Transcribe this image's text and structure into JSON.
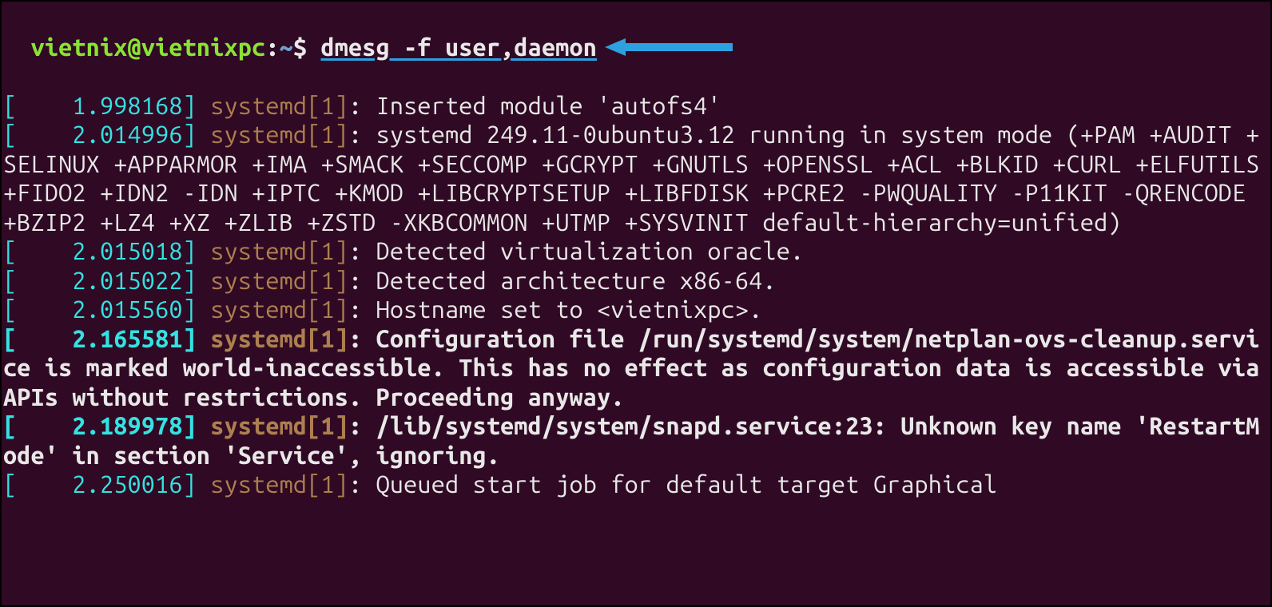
{
  "prompt": {
    "user": "vietnix",
    "at": "@",
    "host": "vietnixpc",
    "colon": ":",
    "path": "~",
    "dollar": "$ ",
    "command": "dmesg -f user,daemon"
  },
  "lines": [
    {
      "open": "[",
      "ts": "    1.998168",
      "close": "] ",
      "proc": "systemd[1]",
      "sep": ": ",
      "msg": "Inserted module 'autofs4'",
      "bold": false
    },
    {
      "open": "[",
      "ts": "    2.014996",
      "close": "] ",
      "proc": "systemd[1]",
      "sep": ": ",
      "msg": "systemd 249.11-0ubuntu3.12 running in system mode (+PAM +AUDIT +SELINUX +APPARMOR +IMA +SMACK +SECCOMP +GCRYPT +GNUTLS +OPENSSL +ACL +BLKID +CURL +ELFUTILS +FIDO2 +IDN2 -IDN +IPTC +KMOD +LIBCRYPTSETUP +LIBFDISK +PCRE2 -PWQUALITY -P11KIT -QRENCODE +BZIP2 +LZ4 +XZ +ZLIB +ZSTD -XKBCOMMON +UTMP +SYSVINIT default-hierarchy=unified)",
      "bold": false
    },
    {
      "open": "[",
      "ts": "    2.015018",
      "close": "] ",
      "proc": "systemd[1]",
      "sep": ": ",
      "msg": "Detected virtualization oracle.",
      "bold": false
    },
    {
      "open": "[",
      "ts": "    2.015022",
      "close": "] ",
      "proc": "systemd[1]",
      "sep": ": ",
      "msg": "Detected architecture x86-64.",
      "bold": false
    },
    {
      "open": "[",
      "ts": "    2.015560",
      "close": "] ",
      "proc": "systemd[1]",
      "sep": ": ",
      "msg": "Hostname set to <vietnixpc>.",
      "bold": false
    },
    {
      "open": "[",
      "ts": "    2.165581",
      "close": "] ",
      "proc": "systemd[1]",
      "sep": ": ",
      "msg": "Configuration file /run/systemd/system/netplan-ovs-cleanup.service is marked world-inaccessible. This has no effect as configuration data is accessible via APIs without restrictions. Proceeding anyway.",
      "bold": true
    },
    {
      "open": "[",
      "ts": "    2.189978",
      "close": "] ",
      "proc": "systemd[1]",
      "sep": ": ",
      "msg": "/lib/systemd/system/snapd.service:23: Unknown key name 'RestartMode' in section 'Service', ignoring.",
      "bold": true
    },
    {
      "open": "[",
      "ts": "    2.250016",
      "close": "] ",
      "proc": "systemd[1]",
      "sep": ": ",
      "msg": "Queued start job for default target Graphical",
      "bold": false
    }
  ]
}
